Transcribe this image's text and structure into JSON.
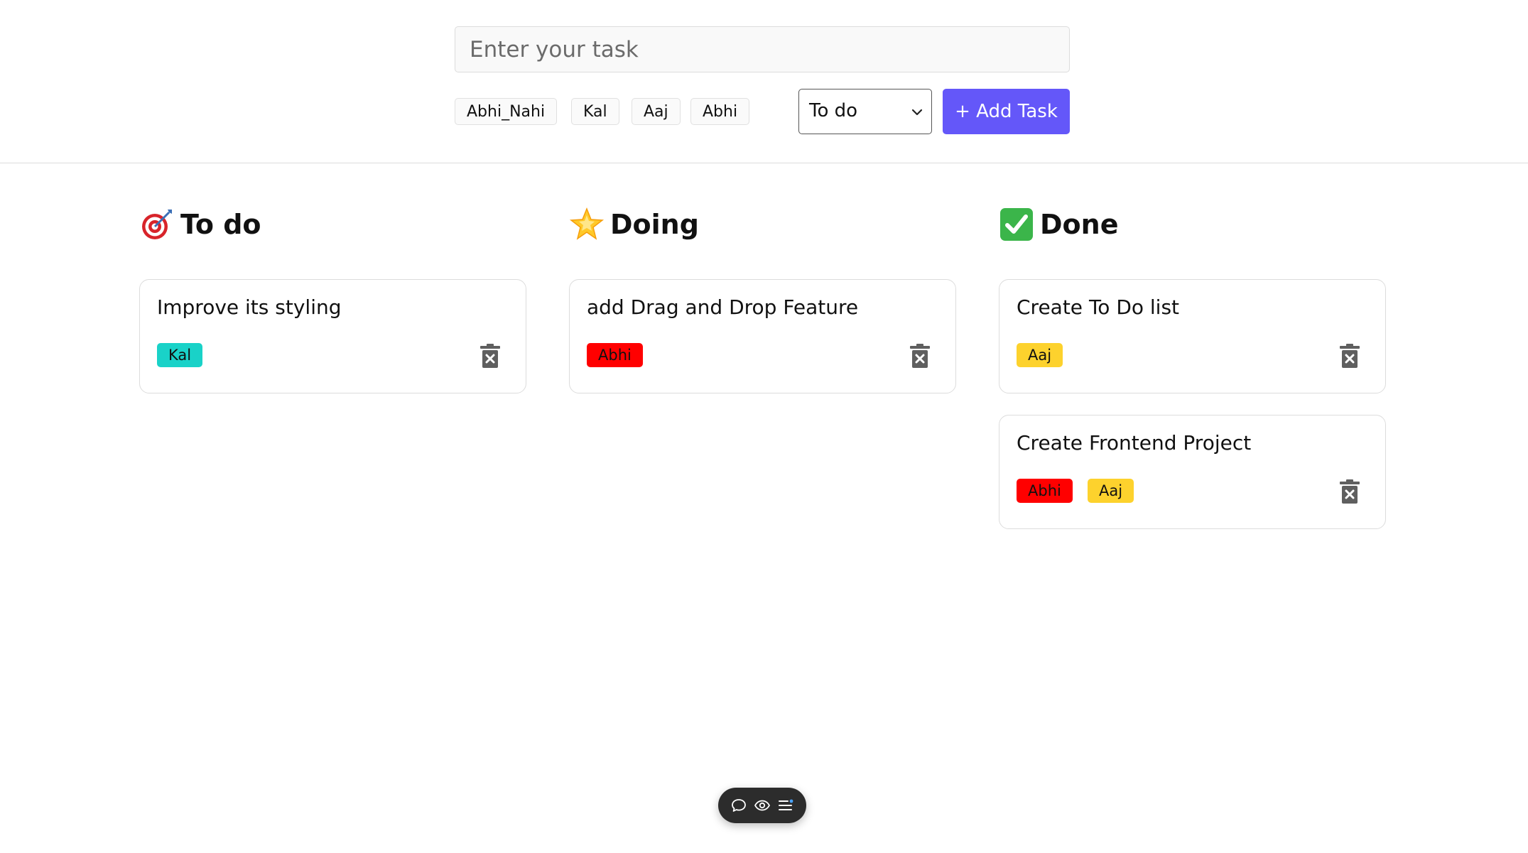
{
  "form": {
    "task_placeholder": "Enter your task",
    "tags": [
      "Abhi_Nahi",
      "Kal",
      "Aaj",
      "Abhi"
    ],
    "status_value": "To do",
    "add_button_label": "+ Add Task"
  },
  "columns": [
    {
      "title": "To do",
      "icon": "target-icon",
      "cards": [
        {
          "title": "Improve its styling",
          "tags": [
            {
              "label": "Kal",
              "color": "#19d2c8"
            }
          ]
        }
      ]
    },
    {
      "title": "Doing",
      "icon": "glowing-star-icon",
      "cards": [
        {
          "title": "add Drag and Drop Feature",
          "tags": [
            {
              "label": "Abhi",
              "color": "#ff0000"
            }
          ]
        }
      ]
    },
    {
      "title": "Done",
      "icon": "check-mark-icon",
      "cards": [
        {
          "title": "Create To Do list",
          "tags": [
            {
              "label": "Aaj",
              "color": "#fdd22d"
            }
          ]
        },
        {
          "title": "Create Frontend Project",
          "tags": [
            {
              "label": "Abhi",
              "color": "#ff0000"
            },
            {
              "label": "Aaj",
              "color": "#fdd22d"
            }
          ]
        }
      ]
    }
  ],
  "colors": {
    "accent": "#6457f9",
    "border": "#dcdcdc",
    "toolbar_bg": "#2c2c2c"
  },
  "floating_toolbar": {
    "icons": [
      "comment-icon",
      "eye-icon",
      "menu-icon"
    ]
  }
}
